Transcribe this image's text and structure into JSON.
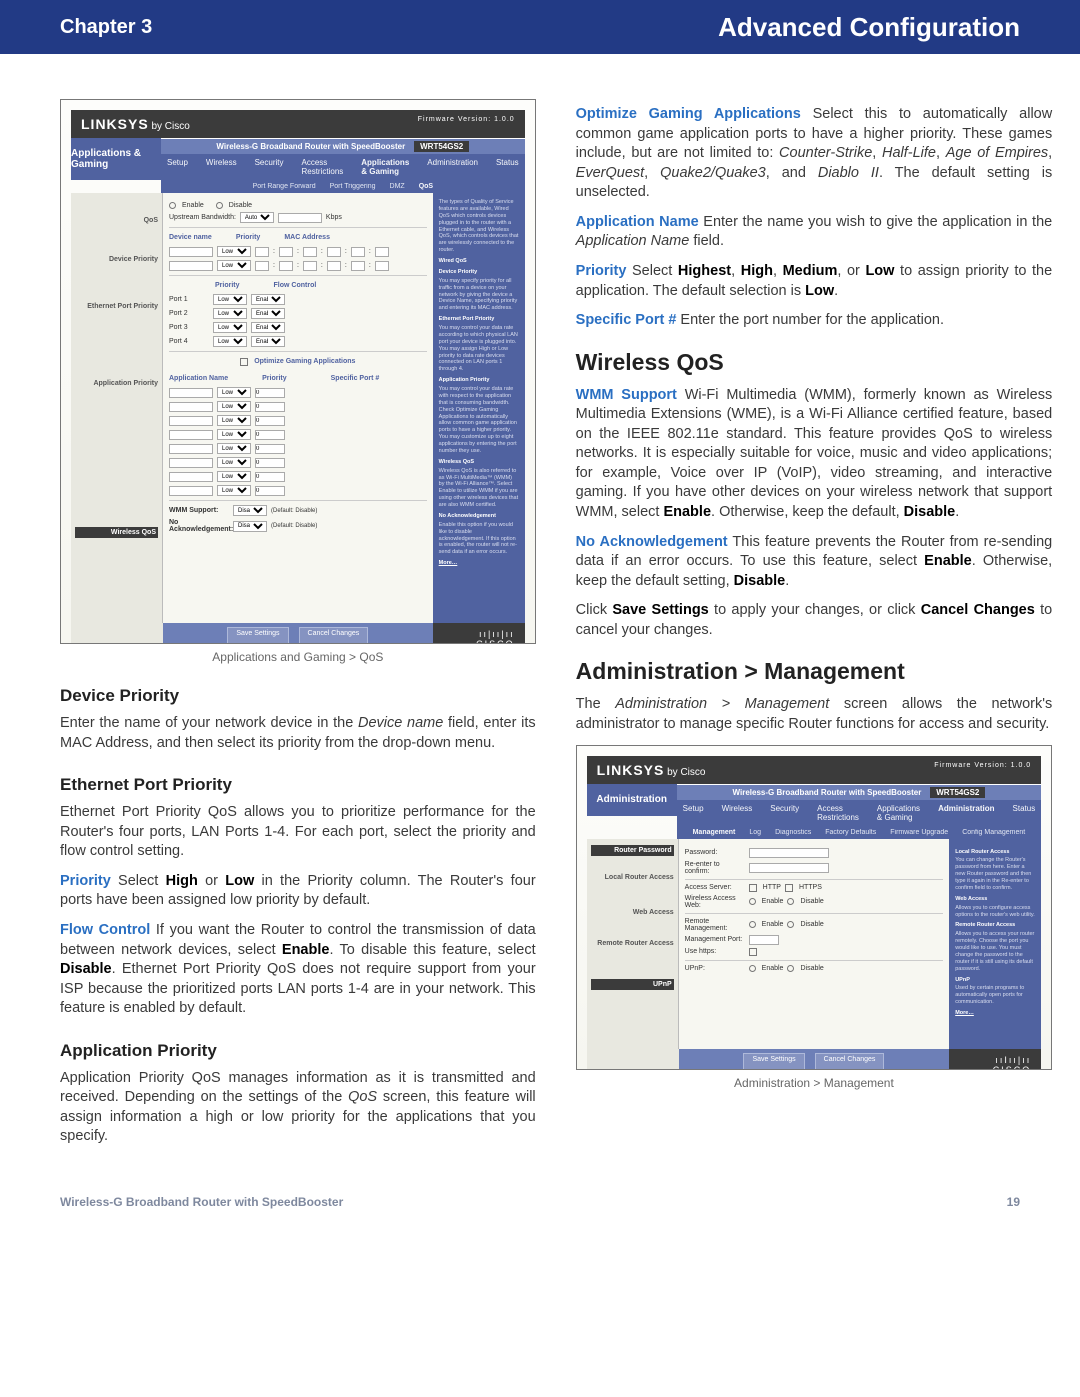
{
  "header": {
    "chapter": "Chapter 3",
    "title": "Advanced Configuration"
  },
  "footer": {
    "product": "Wireless-G Broadband Router with SpeedBooster",
    "page": "19"
  },
  "caption1": "Applications and Gaming > QoS",
  "caption2": "Administration > Management",
  "linksys": {
    "brand": "LINKSYS",
    "by": "by Cisco",
    "model": "WRT54GS2",
    "fw": "Firmware Version: 1.0.0"
  },
  "ss1": {
    "topbar": "Wireless-G Broadband Router with SpeedBooster",
    "side": "Applications & Gaming",
    "tabs": [
      "Setup",
      "Wireless",
      "Security",
      "Access Restrictions",
      "Applications & Gaming",
      "Administration",
      "Status"
    ],
    "subtabs": [
      "Port Range Forward",
      "Port Triggering",
      "DMZ",
      "QoS"
    ],
    "left_labels": [
      "QoS",
      "Device Priority",
      "Ethernet Port Priority",
      "Application Priority",
      "Wireless QoS"
    ],
    "qos_upstream": "Upstream Bandwidth:",
    "qos_auto": "Auto",
    "qos_kbps": "Kbps",
    "enable": "Enable",
    "disable": "Disable",
    "devname": "Device name",
    "priority": "Priority",
    "mac": "MAC Address",
    "flow": "Flow Control",
    "ports": [
      "Port 1",
      "Port 2",
      "Port 3",
      "Port 4"
    ],
    "low": "Low",
    "optimize": "Optimize Gaming Applications",
    "appname": "Application Name",
    "specific": "Specific Port #",
    "wmm": "WMM Support:",
    "noack": "No Acknowledgement:",
    "default": "(Default: Disable)",
    "save": "Save Settings",
    "cancel": "Cancel Changes",
    "cisco": "CISCO",
    "help": {
      "dp": "Device Priority",
      "dptxt": "You may specify priority for all traffic from a device on your network by giving the device a Device Name, specifying priority and entering its MAC address.",
      "epp": "Ethernet Port Priority",
      "epptxt": "You may control your data rate according to which physical LAN port your device is plugged into. You may assign High or Low priority to data rate devices connected on LAN ports 1 through 4.",
      "ap": "Application Priority",
      "aptxt": "You may control your data rate with respect to the application that is consuming bandwidth. Check Optimize Gaming Applications to automatically allow common game application ports to have a higher priority. You may customize up to eight applications by entering the port number they use.",
      "wq": "Wireless QoS",
      "wqtxt": "Wireless QoS is also referred to as Wi-Fi MultiMedia™ (WMM) by the Wi-Fi Alliance™. Select Enable to utilize WMM if you are using other wireless devices that are also WMM certified.",
      "na": "No Acknowledgement",
      "natxt": "Enable this option if you would like to disable acknowledgement. If this option is enabled, the router will not re-send data if an error occurs.",
      "more": "More…"
    }
  },
  "ss2": {
    "side": "Administration",
    "subtabs": [
      "Management",
      "Log",
      "Diagnostics",
      "Factory Defaults",
      "Firmware Upgrade",
      "Config Management"
    ],
    "left_labels": [
      "Router Password",
      "Local Router Access",
      "Web Access",
      "Remote Router Access",
      "UPnP"
    ],
    "pwd": "Password:",
    "reenter": "Re-enter to confirm:",
    "accsrv": "Access Server:",
    "http": "HTTP",
    "https": "HTTPS",
    "wap": "Wireless Access Web:",
    "remote": "Remote Management:",
    "mgmtport": "Management Port:",
    "usehttps": "Use https:",
    "upnp": "UPnP:",
    "help": {
      "lra": "Local Router Access",
      "lratxt": "You can change the Router's password from here. Enter a new Router password and then type it again in the Re-enter to confirm field to confirm.",
      "wa": "Web Access",
      "watxt": "Allows you to configure access options to the router's web utility.",
      "rra": "Remote Router Access",
      "rratxt": "Allows you to access your router remotely. Choose the port you would like to use. You must change the password to the router if it is still using its default password.",
      "up": "UPnP",
      "uptxt": "Used by certain programs to automatically open ports for communication."
    }
  },
  "left": {
    "h1": "Device Priority",
    "p1a": "Enter the name of your network device in the ",
    "p1i": "Device name",
    "p1b": " field, enter its MAC Address, and then select its priority from the drop-down menu.",
    "h2": "Ethernet Port Priority",
    "p2": "Ethernet Port Priority QoS allows you to prioritize performance for the Router's four ports, LAN Ports 1-4.  For each port, select  the priority and flow control setting.",
    "p3lead": "Priority",
    "p3": "  Select ",
    "p3b1": "High",
    "p3mid": " or ",
    "p3b2": "Low",
    "p3end": " in the Priority column. The Router's four ports have been assigned low priority by default.",
    "p4lead": "Flow Control",
    "p4a": " If you want the Router to control the transmission of data between network devices, select ",
    "p4b1": "Enable",
    "p4b": ". To disable this feature, select ",
    "p4b2": "Disable",
    "p4c": ". Ethernet Port Priority QoS does not require support from your ISP because the prioritized ports LAN ports 1-4 are in your network. This feature is enabled by default.",
    "h3": "Application Priority",
    "p5": "Application Priority QoS manages information as it is transmitted and received. Depending on the settings of the ",
    "p5i": "QoS",
    "p5b": " screen, this feature will assign information a high or low priority for the applications that you specify."
  },
  "right": {
    "p1lead": "Optimize Gaming Applications",
    "p1a": " Select this to automatically allow common game application ports to have a higher priority. These games include, but are not limited to: ",
    "p1g1": "Counter-Strike",
    "p1g2": "Half-Life",
    "p1g3": "Age of Empires",
    "p1g4": "EverQuest",
    "p1g5": "Quake2/Quake3",
    "p1g6": "Diablo II",
    "p1b": ". The default setting is unselected.",
    "p2lead": "Application Name",
    "p2": "  Enter the name you wish to give the application in the ",
    "p2i": "Application Name",
    "p2b": " field.",
    "p3lead": "Priority",
    "p3a": "  Select ",
    "p3h": "Highest",
    "p3b": "High",
    "p3m": "Medium",
    "p3l": "Low",
    "p3c": " to assign priority to the application. The default selection is ",
    "p3d": "Low",
    "p3e": ".",
    "p4lead": "Specific Port #",
    "p4": " Enter the port number for the application.",
    "h1": "Wireless QoS",
    "p5lead": "WMM Support",
    "p5": " Wi-Fi Multimedia (WMM), formerly known as Wireless Multimedia Extensions (WME), is a Wi-Fi Alliance certified feature, based on the IEEE 802.11e standard. This feature provides QoS to wireless networks. It is especially suitable for voice, music and video applications; for example, Voice over IP (VoIP), video streaming, and interactive gaming. If you have other devices on your wireless network that support WMM, select ",
    "p5b1": "Enable",
    "p5m": ". Otherwise, keep the default, ",
    "p5b2": "Disable",
    "p5e": ".",
    "p6lead": "No Acknowledgement",
    "p6": "  This feature prevents the Router from re-sending data if an error occurs. To use this feature, select ",
    "p6b1": "Enable",
    "p6m": ". Otherwise, keep the default setting, ",
    "p6b2": "Disable",
    "p6e": ".",
    "p7a": "Click ",
    "p7b1": "Save Settings",
    "p7m": " to apply your changes, or click ",
    "p7b2": "Cancel Changes",
    "p7e": " to cancel your changes.",
    "h2": "Administration > Management",
    "p8a": "The ",
    "p8i": "Administration > Management",
    "p8b": " screen allows the network's administrator to manage specific Router functions for access and security."
  }
}
